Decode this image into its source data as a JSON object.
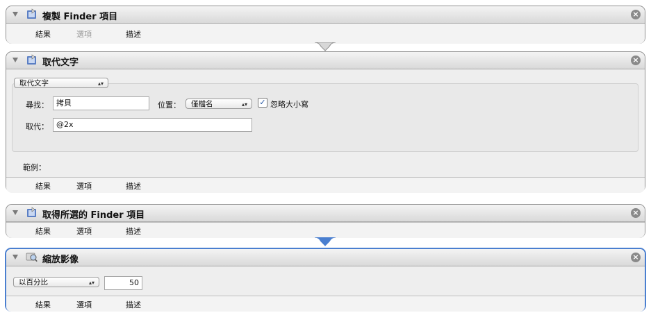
{
  "actions": [
    {
      "title": "複製 Finder 項目",
      "tabs": {
        "results": "結果",
        "options": "選項",
        "description": "描述"
      }
    },
    {
      "title": "取代文字",
      "mode_popup": "取代文字",
      "find_label": "尋找：",
      "find_value": "拷貝",
      "in_label": "位置：",
      "in_popup": "僅檔名",
      "ignore_case_label": "忽略大小寫",
      "ignore_case_checked": true,
      "replace_label": "取代：",
      "replace_value": "@2x",
      "example_label": "範例：",
      "tabs": {
        "results": "結果",
        "options": "選項",
        "description": "描述"
      }
    },
    {
      "title": "取得所選的 Finder 項目",
      "tabs": {
        "results": "結果",
        "options": "選項",
        "description": "描述"
      }
    },
    {
      "title": "縮放影像",
      "scale_popup": "以百分比",
      "scale_value": "50",
      "tabs": {
        "results": "結果",
        "options": "選項",
        "description": "描述"
      }
    }
  ],
  "icons": {
    "finder": "finder-action-icon",
    "text": "text-action-icon",
    "preview": "preview-action-icon",
    "close": "close-icon"
  }
}
